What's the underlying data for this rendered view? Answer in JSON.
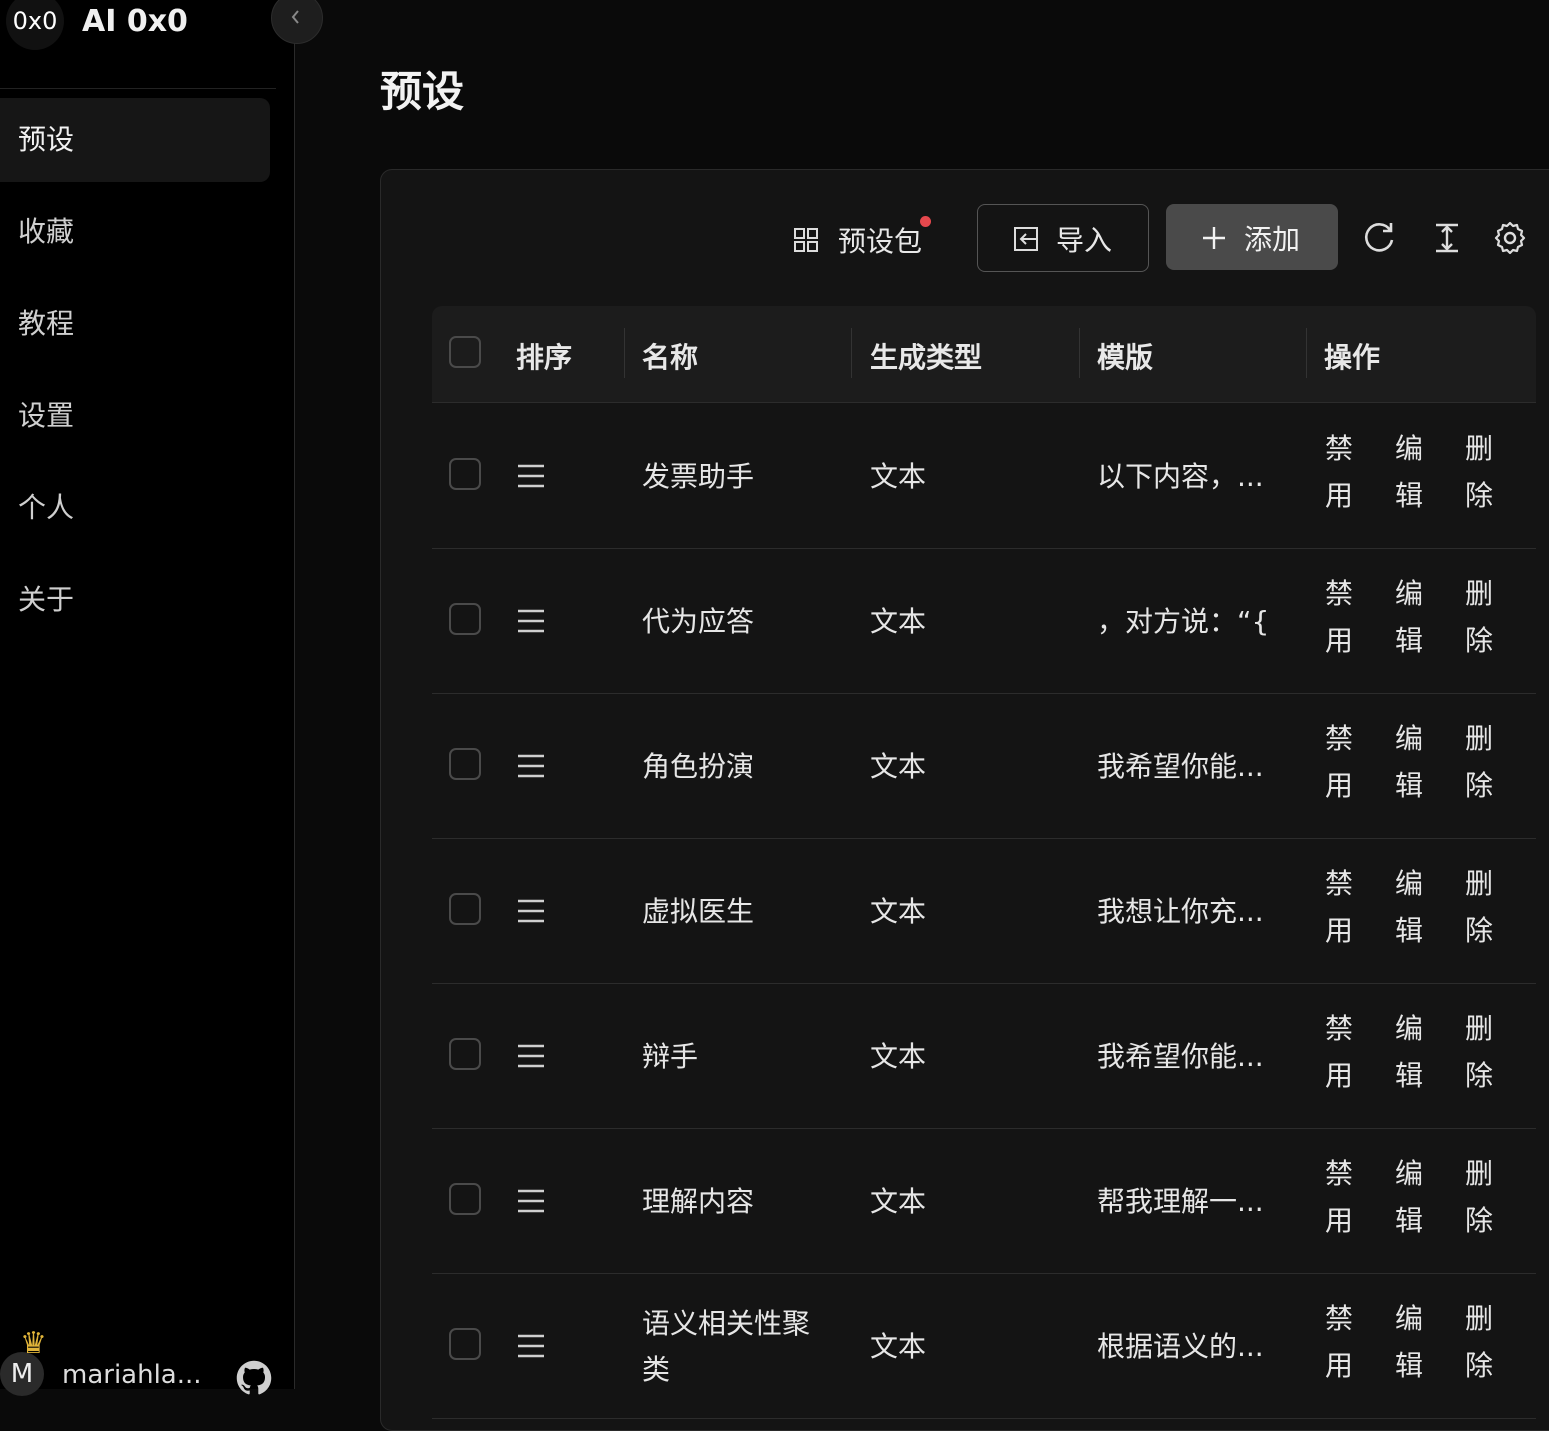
{
  "app": {
    "logo_text": "0x0",
    "title": "AI 0x0"
  },
  "sidebar": {
    "items": [
      {
        "label": "预设",
        "active": true
      },
      {
        "label": "收藏"
      },
      {
        "label": "教程"
      },
      {
        "label": "设置"
      },
      {
        "label": "个人"
      },
      {
        "label": "关于"
      }
    ]
  },
  "user": {
    "avatar_letter": "M",
    "name": "mariahla..."
  },
  "page": {
    "title": "预设"
  },
  "toolbar": {
    "preset_pack_label": "预设包",
    "import_label": "导入",
    "add_label": "添加"
  },
  "table": {
    "headers": {
      "sort": "排序",
      "name": "名称",
      "type": "生成类型",
      "template": "模版",
      "actions": "操作"
    },
    "actions": {
      "disable": "禁用",
      "edit": "编辑",
      "delete": "删除"
    },
    "rows": [
      {
        "name": "发票助手",
        "type": "文本",
        "template": "以下内容，..."
      },
      {
        "name": "代为应答",
        "type": "文本",
        "template": "，对方说：“{..."
      },
      {
        "name": "角色扮演",
        "type": "文本",
        "template": "我希望你能..."
      },
      {
        "name": "虚拟医生",
        "type": "文本",
        "template": "我想让你充..."
      },
      {
        "name": "辩手",
        "type": "文本",
        "template": "我希望你能..."
      },
      {
        "name": "理解内容",
        "type": "文本",
        "template": "帮我理解一..."
      },
      {
        "name": "语义相关性聚类",
        "type": "文本",
        "template": "根据语义的..."
      }
    ]
  },
  "colors": {
    "background": "#0a0a0a",
    "card": "#141414",
    "accent_button": "#4a4a4a",
    "notification_dot": "#e5484d"
  }
}
